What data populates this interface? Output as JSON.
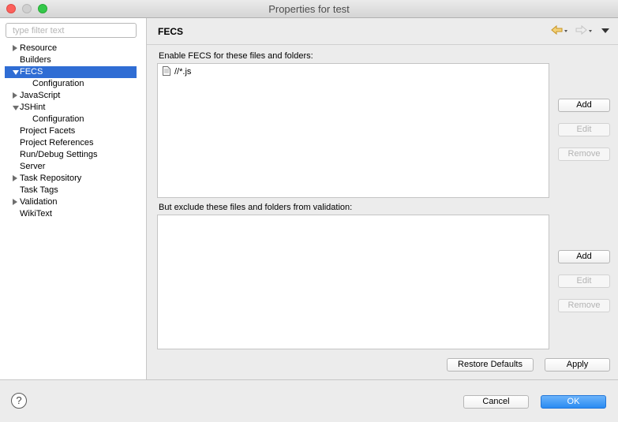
{
  "window": {
    "title": "Properties for test"
  },
  "filter": {
    "placeholder": "type filter text",
    "value": ""
  },
  "tree": [
    {
      "label": "Resource",
      "level": 0,
      "twisty": "collapsed"
    },
    {
      "label": "Builders",
      "level": 0,
      "twisty": "none"
    },
    {
      "label": "FECS",
      "level": 0,
      "twisty": "expanded",
      "selected": true
    },
    {
      "label": "Configuration",
      "level": 1,
      "twisty": "none"
    },
    {
      "label": "JavaScript",
      "level": 0,
      "twisty": "collapsed"
    },
    {
      "label": "JSHint",
      "level": 0,
      "twisty": "expanded"
    },
    {
      "label": "Configuration",
      "level": 1,
      "twisty": "none"
    },
    {
      "label": "Project Facets",
      "level": 0,
      "twisty": "none"
    },
    {
      "label": "Project References",
      "level": 0,
      "twisty": "none"
    },
    {
      "label": "Run/Debug Settings",
      "level": 0,
      "twisty": "none"
    },
    {
      "label": "Server",
      "level": 0,
      "twisty": "none"
    },
    {
      "label": "Task Repository",
      "level": 0,
      "twisty": "collapsed"
    },
    {
      "label": "Task Tags",
      "level": 0,
      "twisty": "none"
    },
    {
      "label": "Validation",
      "level": 0,
      "twisty": "collapsed"
    },
    {
      "label": "WikiText",
      "level": 0,
      "twisty": "none"
    }
  ],
  "page": {
    "title": "FECS"
  },
  "include": {
    "label": "Enable FECS for these files and folders:",
    "items": [
      "//*.js"
    ],
    "add": "Add",
    "edit": "Edit",
    "remove": "Remove"
  },
  "exclude": {
    "label": "But exclude these files and folders from validation:",
    "items": [],
    "add": "Add",
    "edit": "Edit",
    "remove": "Remove"
  },
  "actions": {
    "restore_defaults": "Restore Defaults",
    "apply": "Apply"
  },
  "dialog": {
    "help": "?",
    "cancel": "Cancel",
    "ok": "OK"
  },
  "colors": {
    "selection": "#2f6dd4",
    "ok_button": "#2a8bf2",
    "nav_arrow": "#e8b43c"
  }
}
